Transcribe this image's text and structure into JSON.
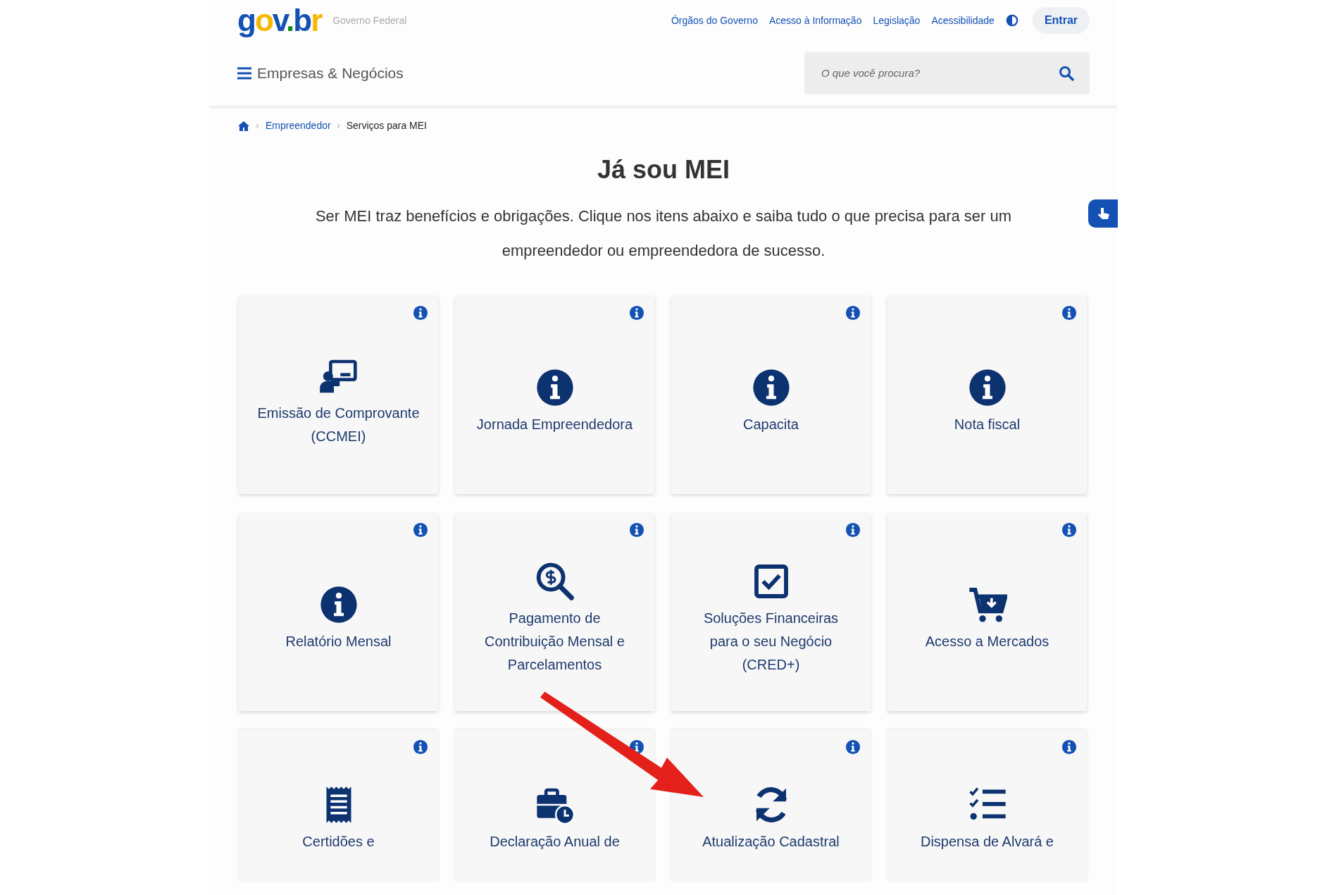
{
  "header": {
    "logo": "gov.br",
    "subtitle": "Governo Federal",
    "links": [
      "Órgãos do Governo",
      "Acesso à Informação",
      "Legislação",
      "Acessibilidade"
    ],
    "login": "Entrar"
  },
  "menu": {
    "title": "Empresas & Negócios"
  },
  "search": {
    "placeholder": "O que você procura?"
  },
  "breadcrumb": [
    "Empreendedor",
    "Serviços para MEI"
  ],
  "title": "Já sou MEI",
  "intro": "Ser MEI traz benefícios e obrigações. Clique nos itens abaixo e saiba tudo o que precisa para ser um empreendedor ou empreendedora de sucesso.",
  "cards": [
    {
      "title": "Emissão de Comprovante (CCMEI)",
      "kind": "presenter"
    },
    {
      "title": "Jornada Empreendedora",
      "kind": "info"
    },
    {
      "title": "Capacita",
      "kind": "info"
    },
    {
      "title": "Nota fiscal",
      "kind": "info"
    },
    {
      "title": "Relatório Mensal",
      "kind": "info"
    },
    {
      "title": "Pagamento de Contribuição Mensal e Parcelamentos",
      "kind": "search"
    },
    {
      "title": "Soluções Financeiras para o seu Negócio (CRED+)",
      "kind": "checkbox"
    },
    {
      "title": "Acesso a Mercados",
      "kind": "cart"
    },
    {
      "title": "Certidões e",
      "kind": "receipt"
    },
    {
      "title": "Declaração Anual de",
      "kind": "briefcase"
    },
    {
      "title": "Atualização Cadastral",
      "kind": "sync"
    },
    {
      "title": "Dispensa de Alvará e",
      "kind": "checklist"
    }
  ]
}
